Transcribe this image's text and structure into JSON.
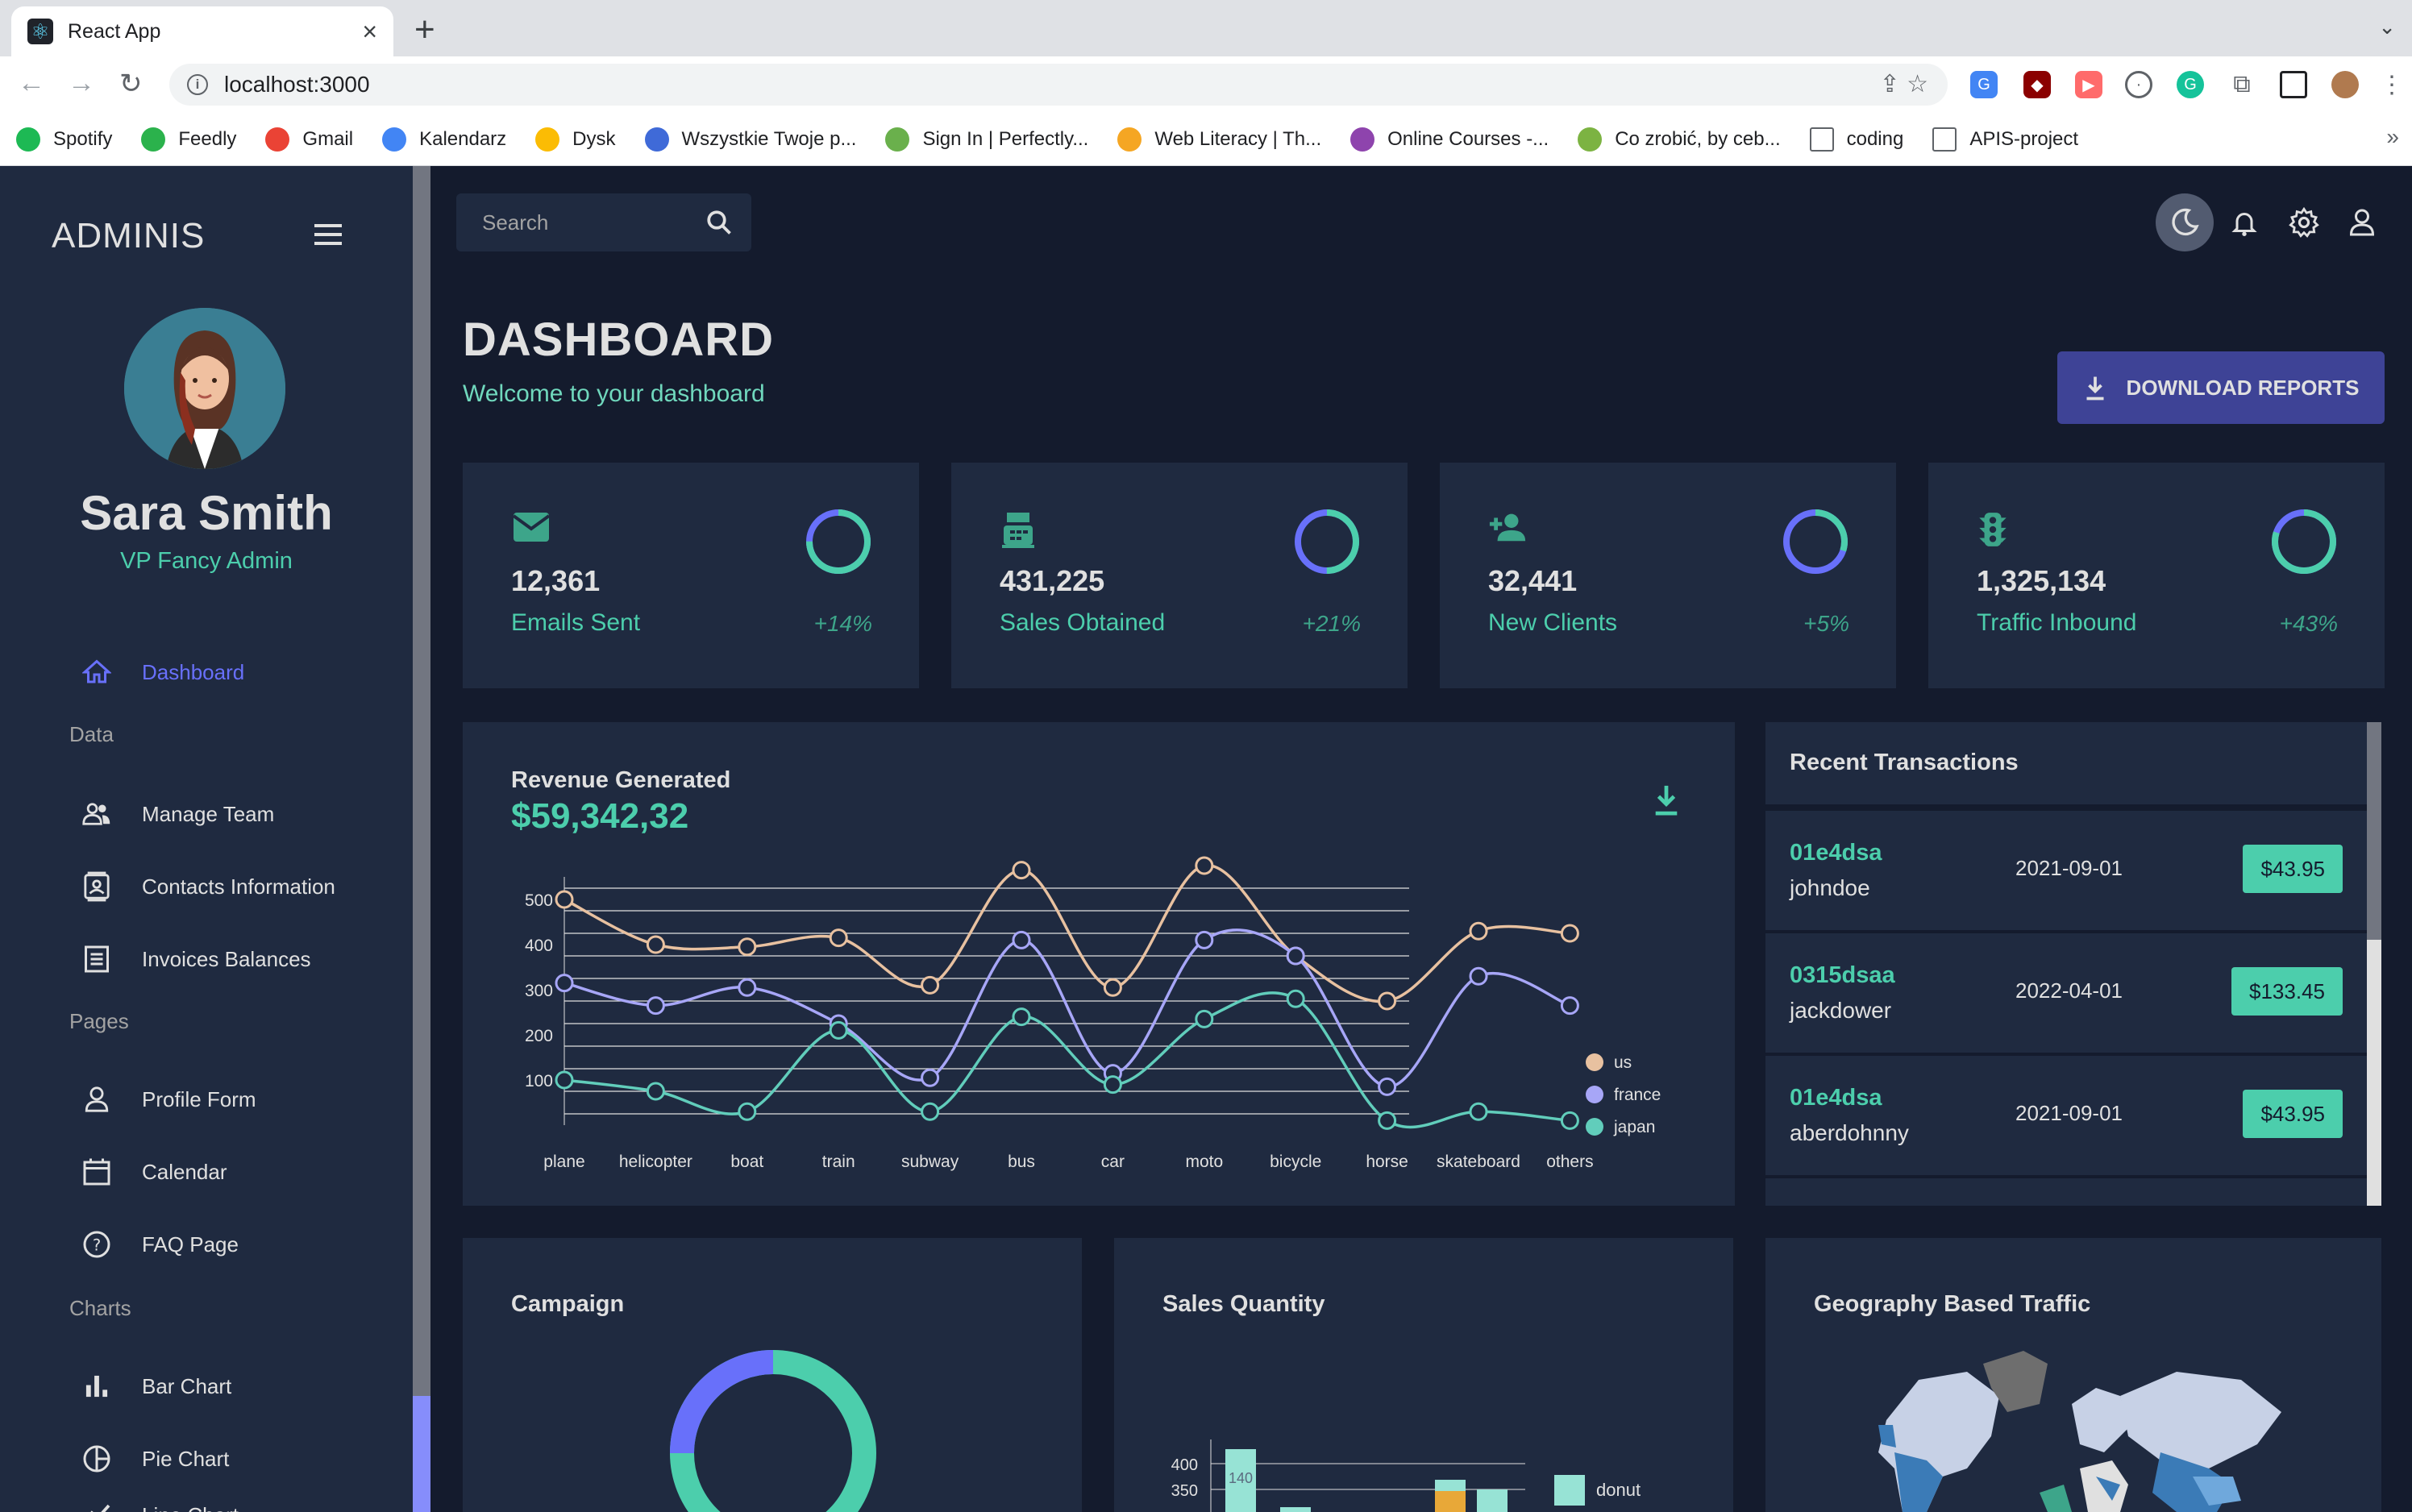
{
  "browser": {
    "tab_title": "React App",
    "url": "localhost:3000",
    "bookmarks": [
      {
        "label": "Spotify",
        "color": "#1db954"
      },
      {
        "label": "Feedly",
        "color": "#2bb24c"
      },
      {
        "label": "Gmail",
        "color": "#ea4335"
      },
      {
        "label": "Kalendarz",
        "color": "#4285f4"
      },
      {
        "label": "Dysk",
        "color": "#fbbc04"
      },
      {
        "label": "Wszystkie Twoje p...",
        "color": "#3f6ad8"
      },
      {
        "label": "Sign In | Perfectly...",
        "color": "#6ab04c"
      },
      {
        "label": "Web Literacy | Th...",
        "color": "#f5a623"
      },
      {
        "label": "Online Courses -...",
        "color": "#8e44ad"
      },
      {
        "label": "Co zrobić, by ceb...",
        "color": "#7cb342"
      },
      {
        "label": "coding",
        "color": "#5f6368"
      },
      {
        "label": "APIS-project",
        "color": "#5f6368"
      }
    ]
  },
  "sidebar": {
    "brand": "ADMINIS",
    "user_name": "Sara Smith",
    "user_role": "VP Fancy Admin",
    "dashboard": "Dashboard",
    "section_data": "Data",
    "manage_team": "Manage Team",
    "contacts": "Contacts Information",
    "invoices": "Invoices Balances",
    "section_pages": "Pages",
    "profile": "Profile Form",
    "calendar": "Calendar",
    "faq": "FAQ Page",
    "section_charts": "Charts",
    "bar_chart": "Bar Chart",
    "pie_chart": "Pie Chart",
    "line_chart": "Line Chart"
  },
  "topbar": {
    "search_placeholder": "Search"
  },
  "header": {
    "title": "DASHBOARD",
    "subtitle": "Welcome to your dashboard",
    "download_label": "DOWNLOAD REPORTS"
  },
  "stats": [
    {
      "value": "12,361",
      "label": "Emails Sent",
      "increase": "+14%",
      "progress": 0.75
    },
    {
      "value": "431,225",
      "label": "Sales Obtained",
      "increase": "+21%",
      "progress": 0.5
    },
    {
      "value": "32,441",
      "label": "New Clients",
      "increase": "+5%",
      "progress": 0.3
    },
    {
      "value": "1,325,134",
      "label": "Traffic Inbound",
      "increase": "+43%",
      "progress": 0.8
    }
  ],
  "revenue": {
    "title": "Revenue Generated",
    "amount": "$59,342,32"
  },
  "chart_data": {
    "type": "line",
    "title": "",
    "x": [
      "plane",
      "helicopter",
      "boat",
      "train",
      "subway",
      "bus",
      "car",
      "moto",
      "bicycle",
      "horse",
      "skateboard",
      "others"
    ],
    "ylim": [
      0,
      550
    ],
    "yticks": [
      100,
      200,
      300,
      400,
      500
    ],
    "series": [
      {
        "name": "us",
        "color": "#e8c1a0",
        "values": [
          500,
          400,
          395,
          415,
          310,
          565,
          305,
          575,
          375,
          275,
          430,
          425
        ]
      },
      {
        "name": "france",
        "color": "#a7a6f7",
        "values": [
          315,
          265,
          305,
          225,
          105,
          410,
          115,
          410,
          375,
          85,
          330,
          265
        ]
      },
      {
        "name": "japan",
        "color": "#61cdbb",
        "values": [
          100,
          75,
          30,
          210,
          30,
          240,
          90,
          235,
          280,
          10,
          30,
          10
        ]
      }
    ],
    "legend_position": "right",
    "grid": true
  },
  "transactions": {
    "title": "Recent Transactions",
    "rows": [
      {
        "id": "01e4dsa",
        "user": "johndoe",
        "date": "2021-09-01",
        "cost": "$43.95"
      },
      {
        "id": "0315dsaa",
        "user": "jackdower",
        "date": "2022-04-01",
        "cost": "$133.45"
      },
      {
        "id": "01e4dsa",
        "user": "aberdohnny",
        "date": "2021-09-01",
        "cost": "$43.95"
      }
    ]
  },
  "campaign": {
    "title": "Campaign"
  },
  "sales": {
    "title": "Sales Quantity",
    "yticks": [
      "400",
      "350"
    ],
    "bar_label": "140",
    "legend": "donut"
  },
  "geography": {
    "title": "Geography Based Traffic"
  }
}
